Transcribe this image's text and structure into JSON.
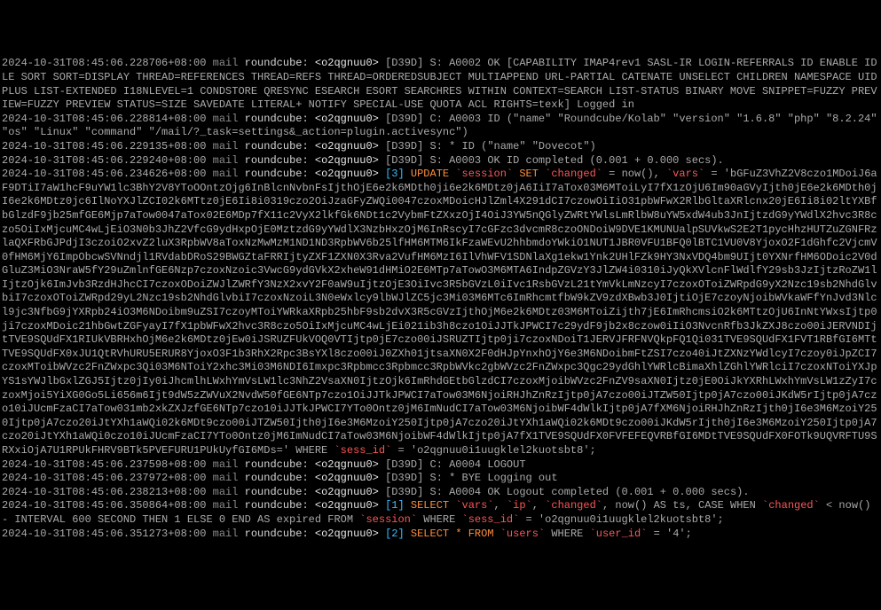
{
  "lines": [
    {
      "ts": "2024-10-31T08:45:06.228706+08:00",
      "host": "mail",
      "proc": "roundcube:",
      "tag": "<o2qgnuu0>",
      "prefix": "[D39D] S: A0002 OK [CAPABILITY IMAP4rev1 SASL-IR LOGIN-REFERRALS ID ENABLE IDLE SORT SORT=DISPLAY THREAD=REFERENCES THREAD=REFS THREAD=ORDEREDSUBJECT MULTIAPPEND URL-PARTIAL CATENATE UNSELECT CHILDREN NAMESPACE UIDPLUS LIST-EXTENDED I18NLEVEL=1 CONDSTORE QRESYNC ESEARCH ESORT SEARCHRES WITHIN CONTEXT=SEARCH LIST-STATUS BINARY MOVE SNIPPET=FUZZY PREVIEW=FUZZY PREVIEW STATUS=SIZE SAVEDATE LITERAL+ NOTIFY SPECIAL-USE QUOTA ACL RIGHTS=texk] Logged in"
    },
    {
      "ts": "2024-10-31T08:45:06.228814+08:00",
      "host": "mail",
      "proc": "roundcube:",
      "tag": "<o2qgnuu0>",
      "prefix": "[D39D] C: A0003 ID (\"name\" \"Roundcube/Kolab\" \"version\" \"1.6.8\" \"php\" \"8.2.24\" \"os\" \"Linux\" \"command\" \"/mail/?_task=settings&_action=plugin.activesync\")"
    },
    {
      "ts": "2024-10-31T08:45:06.229135+08:00",
      "host": "mail",
      "proc": "roundcube:",
      "tag": "<o2qgnuu0>",
      "prefix": "[D39D] S: * ID (\"name\" \"Dovecot\")"
    },
    {
      "ts": "2024-10-31T08:45:06.229240+08:00",
      "host": "mail",
      "proc": "roundcube:",
      "tag": "<o2qgnuu0>",
      "prefix": "[D39D] S: A0003 OK ID completed (0.001 + 0.000 secs)."
    },
    {
      "ts": "2024-10-31T08:45:06.234626+08:00",
      "host": "mail",
      "proc": "roundcube:",
      "tag": "<o2qgnuu0>",
      "sqlnum": "[3]",
      "sql_pre": "UPDATE ",
      "sql_tbl": "`session`",
      "sql_mid": " SET ",
      "sql_col1": "`changed`",
      "sql_eq": " = now(), ",
      "sql_col2": "`vars`",
      "sql_val_intro": " = 'bGFuZ3VhZ2V8czo1MDoiJ6aF9DTiI7aW1hcF9uYW1lc3BhY2V8YToOOntzOjg6InBlcnNvbnFsIjthOjE6e2k6MDth0ji6e2k6MDtz0jA6IiI7aTox03M6MToiLyI7fX1zOjU6Im90aGVyIjth0jE6e2k6MDth0jI6e2k6MDtz0jc6IlNoYXJlZCI02k6MTtz0jE6Ii8i0319czo2OiJzaGFyZWQi0047czoxMDoicHJlZml4X291dCI7czowOiIiO31pbWFwX2RlbGltaXRlcnx20jE6Ii8i02ltYXBfbGlzdF9jb25mfGE6Mjp7aTow0047aTox02E6MDp7fX11c2VyX2lkfGk6NDt1c2VybmFtZXxzOjI4OiJ3YW5nQGlyZWRtYWlsLmRlbW8uYW5xdW4ub3JnIjtzdG9yYWdlX2hvc3R8czo5OiIxMjcuMC4wLjEiO3N0b3JhZ2VfcG9ydHxpOjE0MztzdG9yYWdlX3NzbHxzOjM6InRscyI7cGFzc3dvcmR8czoONDoiW9DVE1KMUNUalpSUVkwS2E2T1pycHhzHUTZuZGNFRzlaQXFRbGJPdjI3czoiO2xvZ2luX3RpbWV8aToxNzMwMzM1ND1ND3RpbWV6b25lfHM6MTM6IkFzaWEvU2hhbmdoYWkiO1NUT1JBR0VFU1BFQ0lBTC1VU0V8YjoxO2F1dGhfc2VjcmV0fHM6MjY6ImpObcwSVNndjl1RVdabDRoS29BWGZtaFRRIjtyZXF1ZXN0X3Rva2VufHM6MzI6IlVhWFV1SDNlaXg1ekw1Ynk2UHlFZk9HY3NxVDQ4bm9UIjt0YXNrfHM6ODoic2V0dGluZ3MiO3NraW5fY29uZmlnfGE6Nzp7czoxNzoic3VwcG9ydGVkX2xheW91dHMiO2E6MTp7aTowO3M6MTA6IndpZGVzY3JlZW4i0310iJyQkXVlcnFlWdlfY29sb3JzIjtzRoZW1lIjtzOjk6ImJvb3RzdHJhcCI7czoxODoiZWJlZWRfY3NzX2xvY2F0aW9uIjtzOjE3OiIvc3R5bGVzL0iIvc1RsbGVzL21tYmVkLmNzcyI7czoxOToiZWRpdG9yX2Nzc19sb2NhdGlvbiI7czoxOToiZWRpd29yL2Nzc19sb2NhdGlvbiI7czoxNzoiL3N0eWxlcy9lbWJlZC5jc3Mi03M6MTc6ImRhcmtfbW9kZV9zdXBwb3J0IjtiOjE7czoyNjoibWVkaWFfYnJvd3Nlcl9jc3NfbG9jYXRpb24iO3M6NDoibm9uZSI7czoyMToiYWRkaXRpb25hbF9sb2dvX3R5cGVzIjthOjM6e2k6MDtz03M6MToiZijth7jE6ImRhcmsiO2k6MTtzOjU6InNtYWxsIjtp0ji7czoxMDoic21hbGwtZGFyayI7fX1pbWFwX2hvc3R8czo5OiIxMjcuMC4wLjEi021ib3h8czo1OiJJTkJPWCI7c29ydF9jb2x8czow0iIiO3NvcnRfb3JkZXJ8czo00iJERVNDIjtTVE9SQUdFX1RIUkVBRHxhOjM6e2k6MDtz0jEw0iJSRUZFUkVOQ0VTIjtp0jE7czo00iJSRUZTIjtp0ji7czoxNDoiT1JERVJFRFNVQkpFQ1Qi031TVE9SQUdFX1FVT1RBfGI6MTtTVE9SQUdFX0xJU1QtRVhURU5ERUR8YjoxO3F1b3RhX2Rpc3BsYXl8czo00iJ0ZXh01jtsaXN0X2F0dHJpYnxhOjY6e3M6NDoibmFtZSI7czo40iJtZXNzYWdlcyI7czoy0iJpZCI7czoxMToibWVzc2FnZWxpc3Qi03M6NToiY2xhc3Mi03M6NDI6Imxpc3Rpbmcc3Rpbmcc3RpbWVkc2gbWVzc2FnZWxpc3Qgc29ydGhlYWRlcBimaXhlZGhlYWRlciI7czoxNToiYXJpYS1sYWJlbGxlZGJ5Ijtz0jIy0iJhcmlhLWxhYmVsLW1lc3NhZ2VsaXN0IjtzOjk6ImRhdGEtbGlzdCI7czoxMjoibWVzc2FnZV9saXN0Ijtz0jE0OiJkYXRhLWxhYmVsLW1zZyI7czoxMjoi5YiXG0Go5Li656m6Ijt9dW5zZWVuX2NvdW50fGE6NTp7czo1OiJJTkJPWCI7aTow03M6NjoiRHJhZnRzIjtp0jA7czo00iJTZW50Ijtp0jA7czo00iJKdW5rIjtp0jA7czo10iJUcmFzaCI7aTow031mb2xkZXJzfGE6NTp7czo10iJJTkJPWCI7YTo0Ontz0jM6ImNudCI7aTow03M6NjoibWF4dWlkIjtp0jA7fXM6NjoiRHJhZnRzIjth0jI6e3M6MzoiY250Ijtp0jA7czo20iJtYXh1aWQi02k6MDt9czo00iJTZW50Ijth0jI6e3M6MzoiY250Ijtp0jA7czo20iJtYXh1aWQi02k6MDt9czo00iJKdW5rIjth0jI6e3M6MzoiY250Ijtp0jA7czo20iJtYXh1aWQi0czo10iJUcmFzaCI7YTo0Ontz0jM6ImNudCI7aTow03M6NjoibWF4dWlkIjtp0jA7fX1TVE9SQUdFX0FVFEFEQVRBfGI6MDtTVE9SQUdFX0FOTk9UQVRFTU9SRXxiOjA7U1RPUkFHRV9BTk5PVEFURU1PUkUyfGI6MDs=' WHERE ",
      "sql_col3": "`sess_id`",
      "sql_where": " = 'o2qgnuu0i1uugklel2kuotsbt8';"
    },
    {
      "ts": "2024-10-31T08:45:06.237598+08:00",
      "host": "mail",
      "proc": "roundcube:",
      "tag": "<o2qgnuu0>",
      "prefix": "[D39D] C: A0004 LOGOUT"
    },
    {
      "ts": "2024-10-31T08:45:06.237972+08:00",
      "host": "mail",
      "proc": "roundcube:",
      "tag": "<o2qgnuu0>",
      "prefix": "[D39D] S: * BYE Logging out"
    },
    {
      "ts": "2024-10-31T08:45:06.238213+08:00",
      "host": "mail",
      "proc": "roundcube:",
      "tag": "<o2qgnuu0>",
      "prefix": "[D39D] S: A0004 OK Logout completed (0.001 + 0.000 secs)."
    },
    {
      "ts": "2024-10-31T08:45:06.350864+08:00",
      "host": "mail",
      "proc": "roundcube:",
      "tag": "<o2qgnuu0>",
      "sqlnum": "[1]",
      "sql_select": "SELECT ",
      "c1": "`vars`",
      "sep1": ", ",
      "c2": "`ip`",
      "sep2": ", ",
      "c3": "`changed`",
      "mid": ", now() AS ts, CASE WHEN ",
      "c4": "`changed`",
      "mid2": " < now() - INTERVAL 600 SECOND THEN 1 ELSE 0 END AS expired FROM ",
      "tbl": "`session`",
      "mid3": " WHERE ",
      "c5": "`sess_id`",
      "end": " = 'o2qgnuu0i1uugklel2kuotsbt8';"
    },
    {
      "ts": "2024-10-31T08:45:06.351273+08:00",
      "host": "mail",
      "proc": "roundcube:",
      "tag": "<o2qgnuu0>",
      "sqlnum": "[2]",
      "sql_select": "SELECT * FROM ",
      "tbl": "`users`",
      "mid": " WHERE ",
      "c1": "`user_id`",
      "end": " = '4';"
    }
  ]
}
